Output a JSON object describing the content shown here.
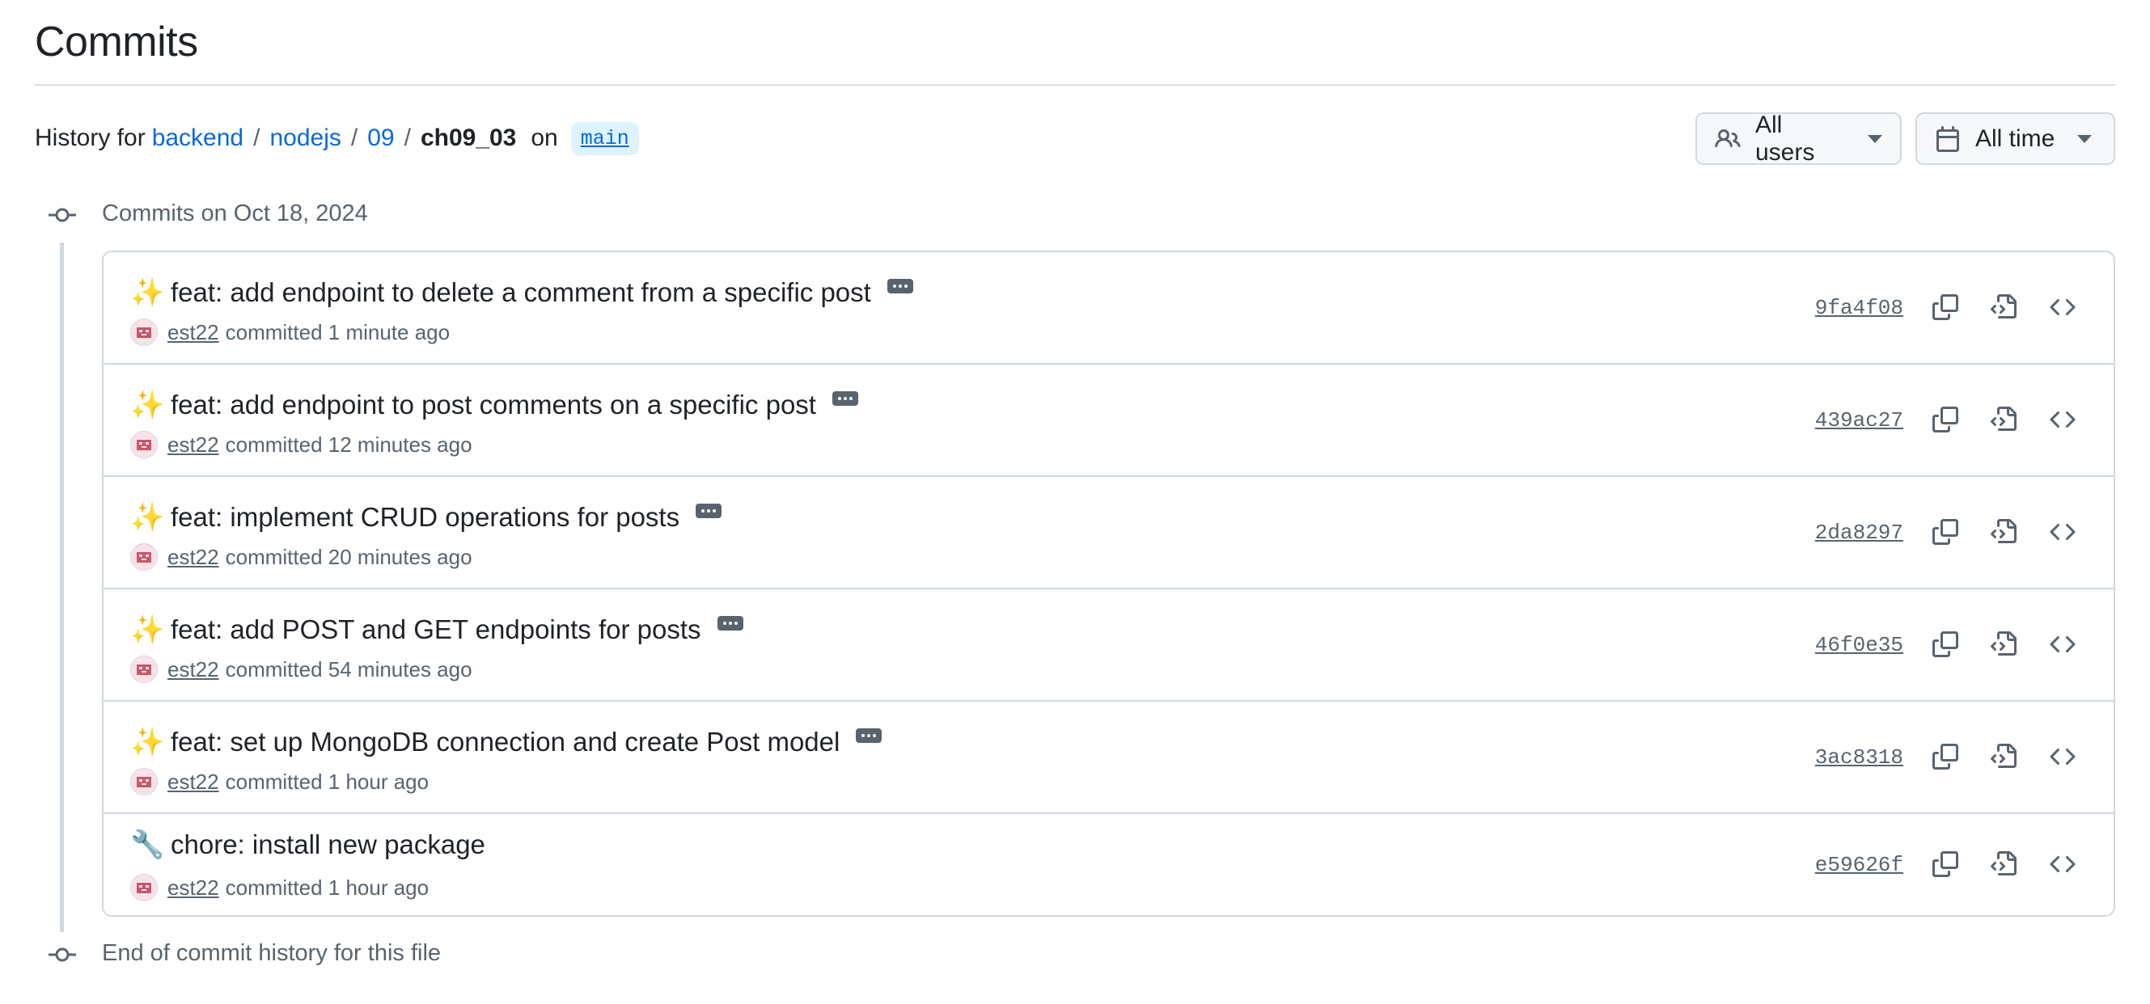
{
  "page": {
    "title": "Commits"
  },
  "history": {
    "prefix": "History for",
    "crumbs": [
      "backend",
      "nodejs",
      "09"
    ],
    "separator": "/",
    "current": "ch09_03",
    "on_label": "on",
    "branch": "main"
  },
  "filters": {
    "users_label": "All users",
    "time_label": "All time"
  },
  "timeline": {
    "group_label": "Commits on Oct 18, 2024",
    "end_label": "End of commit history for this file"
  },
  "commits": [
    {
      "emoji": "✨",
      "message": "feat: add endpoint to delete a comment from a specific post",
      "has_more": true,
      "author": "est22",
      "action": "committed",
      "time": "1 minute ago",
      "sha": "9fa4f08"
    },
    {
      "emoji": "✨",
      "message": "feat: add endpoint to post comments on a specific post",
      "has_more": true,
      "author": "est22",
      "action": "committed",
      "time": "12 minutes ago",
      "sha": "439ac27"
    },
    {
      "emoji": "✨",
      "message": "feat: implement CRUD operations for posts",
      "has_more": true,
      "author": "est22",
      "action": "committed",
      "time": "20 minutes ago",
      "sha": "2da8297"
    },
    {
      "emoji": "✨",
      "message": "feat: add POST and GET endpoints for posts",
      "has_more": true,
      "author": "est22",
      "action": "committed",
      "time": "54 minutes ago",
      "sha": "46f0e35"
    },
    {
      "emoji": "✨",
      "message": "feat: set up MongoDB connection and create Post model",
      "has_more": true,
      "author": "est22",
      "action": "committed",
      "time": "1 hour ago",
      "sha": "3ac8318"
    },
    {
      "emoji": "🔧",
      "message": "chore: install new package",
      "has_more": false,
      "author": "est22",
      "action": "committed",
      "time": "1 hour ago",
      "sha": "e59626f"
    }
  ],
  "icons": {
    "users": "people-icon",
    "time": "calendar-icon",
    "commit_node": "git-commit-icon",
    "copy": "copy-icon",
    "browse_file": "file-code-icon",
    "browse_repo": "code-icon"
  },
  "colors": {
    "link": "#0969da",
    "branch_bg": "#ddf4ff",
    "border": "#d1d9e0",
    "muted": "#59636e"
  }
}
